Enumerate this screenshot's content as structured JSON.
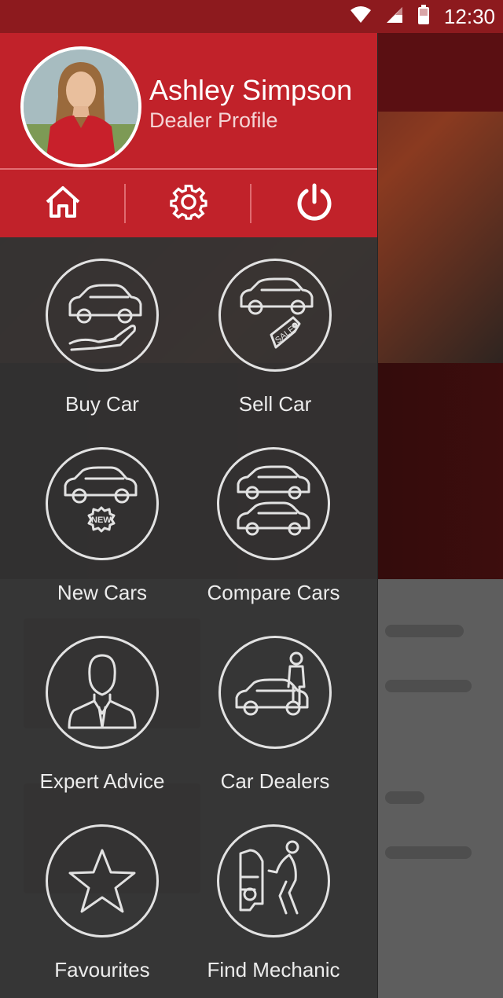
{
  "status_bar": {
    "time": "12:30",
    "icons": [
      "wifi-icon",
      "signal-icon",
      "battery-icon"
    ]
  },
  "drawer": {
    "user": {
      "name": "Ashley Simpson",
      "role": "Dealer Profile"
    },
    "quick_actions": [
      "home-icon",
      "settings-icon",
      "power-icon"
    ],
    "menu": [
      {
        "label": "Buy Car",
        "icon": "buy-car-icon"
      },
      {
        "label": "Sell Car",
        "icon": "sell-car-icon"
      },
      {
        "label": "New Cars",
        "icon": "new-cars-icon"
      },
      {
        "label": "Compare Cars",
        "icon": "compare-cars-icon"
      },
      {
        "label": "Expert Advice",
        "icon": "expert-advice-icon"
      },
      {
        "label": "Car Dealers",
        "icon": "car-dealers-icon"
      },
      {
        "label": "Favourites",
        "icon": "star-icon"
      },
      {
        "label": "Find Mechanic",
        "icon": "mechanic-icon"
      }
    ],
    "badges": {
      "sale": "SALE",
      "new": "NEW"
    }
  },
  "colors": {
    "primary": "#c1222a",
    "status_bar": "#8d1a1e",
    "drawer_bg": "#343434",
    "icon_stroke": "#e2e2e2"
  }
}
